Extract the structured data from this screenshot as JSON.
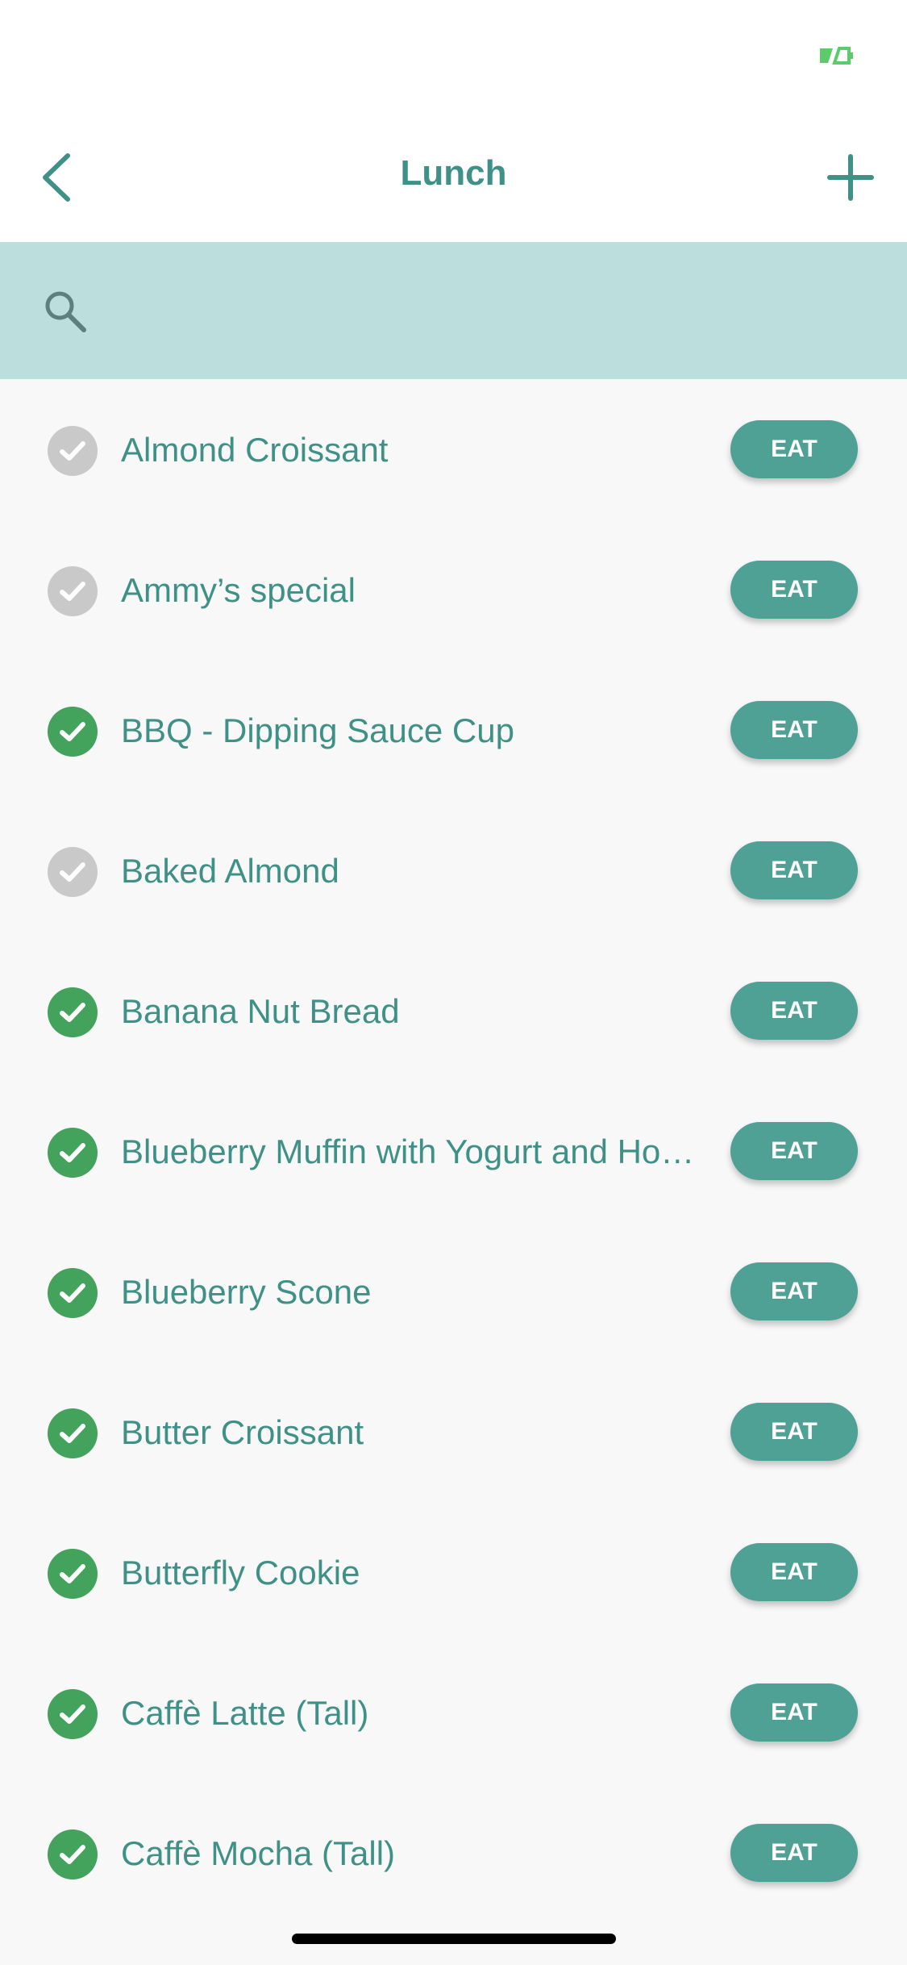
{
  "status_bar": {
    "battery_icon": "battery-icon",
    "battery_color": "#5ccb6a"
  },
  "nav": {
    "title": "Lunch",
    "back_icon": "chevron-left-icon",
    "add_icon": "plus-icon"
  },
  "search": {
    "icon": "search-icon",
    "placeholder": "",
    "value": ""
  },
  "colors": {
    "accent": "#3f9187",
    "button": "#4fa095",
    "search_bg": "#bcdedd",
    "check_on": "#43a25c",
    "check_off": "#c9c9c9"
  },
  "items": [
    {
      "name": "Almond Croissant",
      "checked": false,
      "action": "EAT"
    },
    {
      "name": "Ammy’s special",
      "checked": false,
      "action": "EAT"
    },
    {
      "name": "BBQ - Dipping Sauce Cup",
      "checked": true,
      "action": "EAT"
    },
    {
      "name": "Baked Almond",
      "checked": false,
      "action": "EAT"
    },
    {
      "name": "Banana Nut Bread",
      "checked": true,
      "action": "EAT"
    },
    {
      "name": "Blueberry Muffin with Yogurt and Honey",
      "checked": true,
      "action": "EAT"
    },
    {
      "name": "Blueberry Scone",
      "checked": true,
      "action": "EAT"
    },
    {
      "name": "Butter Croissant",
      "checked": true,
      "action": "EAT"
    },
    {
      "name": "Butterfly Cookie",
      "checked": true,
      "action": "EAT"
    },
    {
      "name": "Caffè Latte (Tall)",
      "checked": true,
      "action": "EAT"
    },
    {
      "name": "Caffè Mocha (Tall)",
      "checked": true,
      "action": "EAT"
    }
  ]
}
